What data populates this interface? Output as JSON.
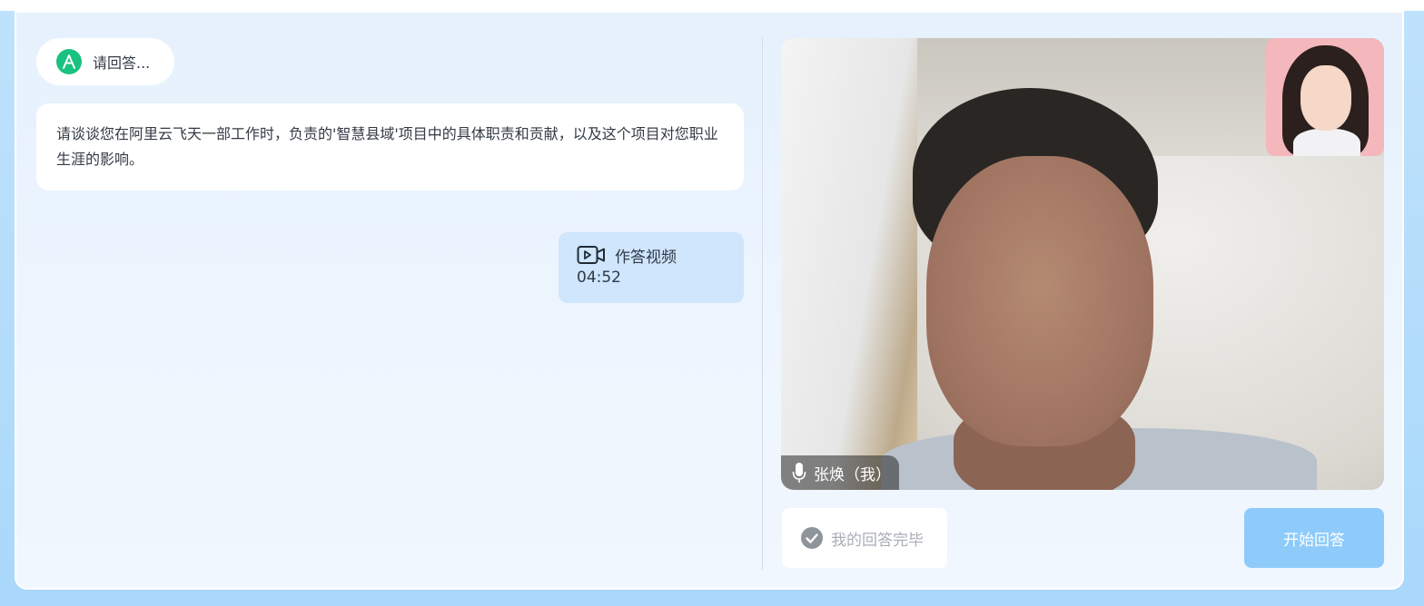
{
  "ai": {
    "avatar_letter": "A",
    "status": "请回答..."
  },
  "question": {
    "text": "请谈谈您在阿里云飞天一部工作时，负责的'智慧县域'项目中的具体职责和贡献，以及这个项目对您职业生涯的影响。"
  },
  "answer": {
    "icon": "video-icon",
    "label": "作答视频",
    "duration": "04:52"
  },
  "video": {
    "user_name": "张焕（我）",
    "mic_icon": "microphone-icon"
  },
  "actions": {
    "done_label": "我的回答完毕",
    "done_icon": "check-circle-icon",
    "start_label": "开始回答"
  },
  "colors": {
    "accent_green": "#19c27e",
    "answer_bubble": "#cfe6fc",
    "start_button": "#8ecbfb"
  }
}
